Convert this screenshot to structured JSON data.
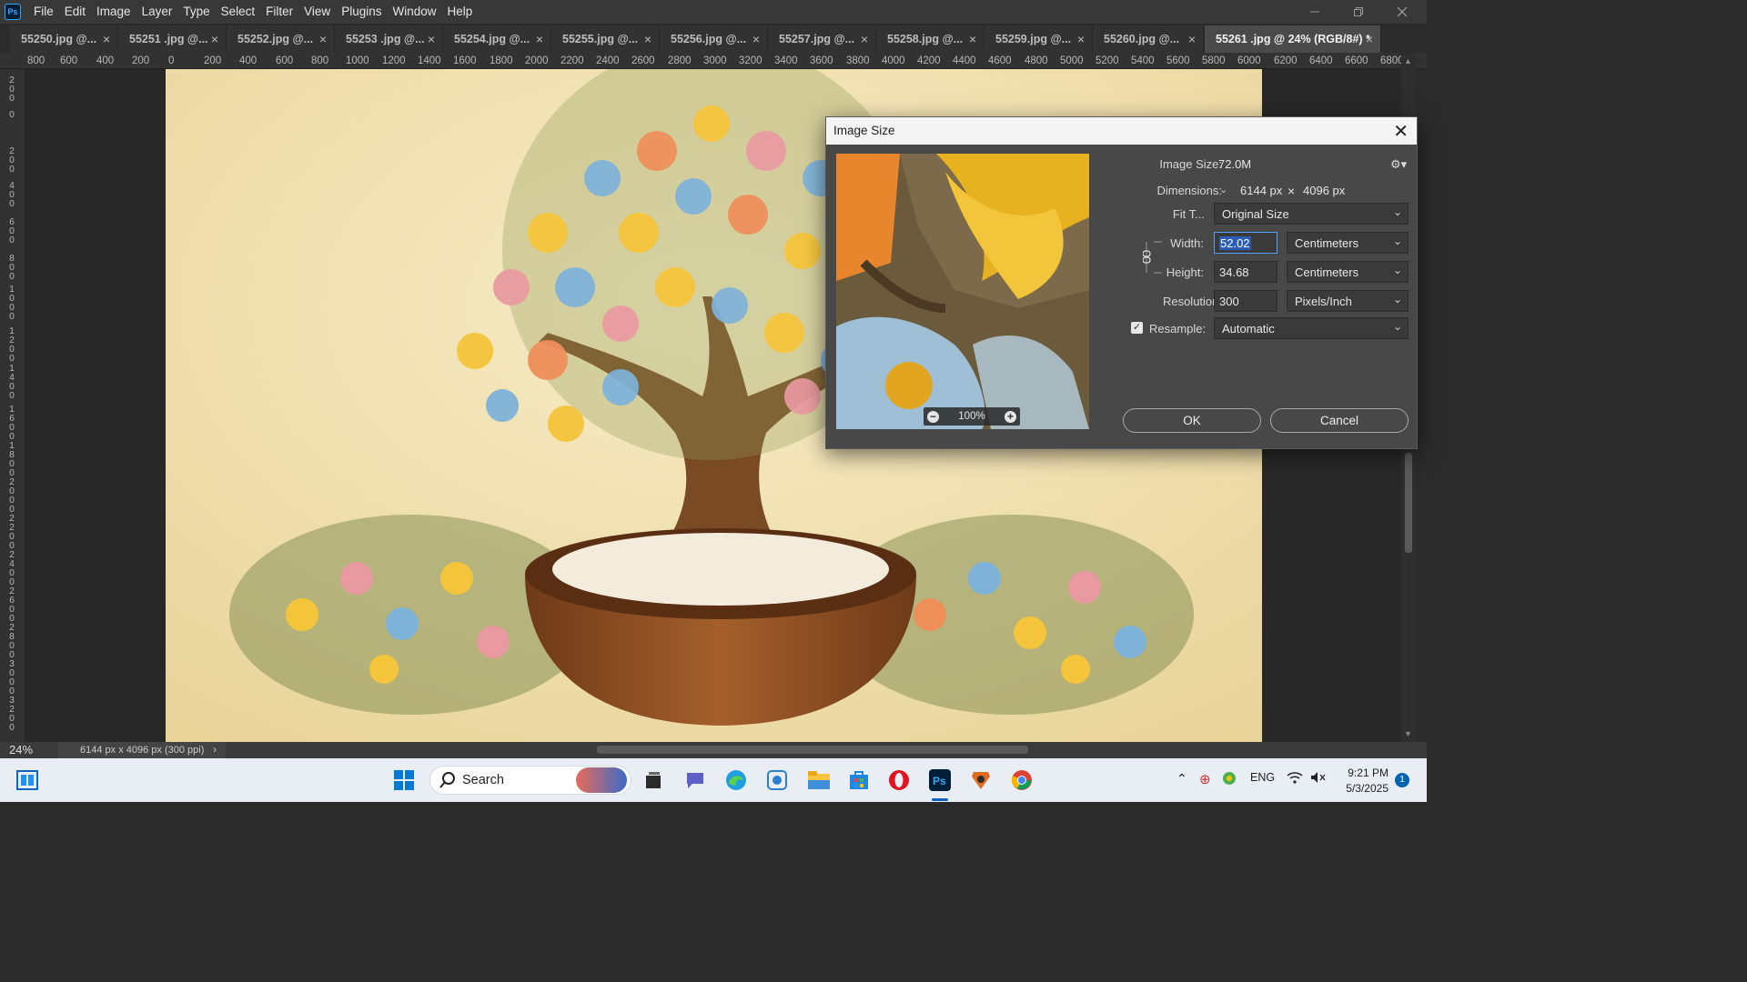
{
  "app": {
    "logo_text": "Ps"
  },
  "menu": [
    "File",
    "Edit",
    "Image",
    "Layer",
    "Type",
    "Select",
    "Filter",
    "View",
    "Plugins",
    "Window",
    "Help"
  ],
  "tabs": [
    {
      "label": "55250.jpg @...",
      "active": false
    },
    {
      "label": "55251 .jpg @...",
      "active": false
    },
    {
      "label": "55252.jpg @...",
      "active": false
    },
    {
      "label": "55253 .jpg @...",
      "active": false
    },
    {
      "label": "55254.jpg @...",
      "active": false
    },
    {
      "label": "55255.jpg @...",
      "active": false
    },
    {
      "label": "55256.jpg @...",
      "active": false
    },
    {
      "label": "55257.jpg @...",
      "active": false
    },
    {
      "label": "55258.jpg @...",
      "active": false
    },
    {
      "label": "55259.jpg @...",
      "active": false
    },
    {
      "label": "55260.jpg @...",
      "active": false
    },
    {
      "label": "55261 .jpg @ 24% (RGB/8#) *",
      "active": true
    }
  ],
  "ruler_top": [
    "800",
    "600",
    "400",
    "200",
    "0",
    "200",
    "400",
    "600",
    "800",
    "1000",
    "1200",
    "1400",
    "1600",
    "1800",
    "2000",
    "2200",
    "2400",
    "2600",
    "2800",
    "3000",
    "3200",
    "3400",
    "3600",
    "3800",
    "4000",
    "4200",
    "4400",
    "4600",
    "4800",
    "5000",
    "5200",
    "5400",
    "5600",
    "5800",
    "6000",
    "6200",
    "6400",
    "6600",
    "6800"
  ],
  "ruler_left": [
    "200",
    "0",
    "200",
    "400",
    "600",
    "800",
    "1000",
    "1200",
    "1400",
    "1600",
    "1800",
    "2000",
    "2200",
    "2400",
    "2600",
    "2800",
    "3000",
    "3200",
    "3400",
    "3600"
  ],
  "status": {
    "zoom": "24%",
    "doc_info": "6144 px x 4096 px (300 ppi)",
    "arrow": "›"
  },
  "dialog": {
    "title": "Image Size",
    "image_size_label": "Image Size:",
    "image_size_value": "72.0M",
    "dimensions_label": "Dimensions:",
    "dim_width": "6144 px",
    "dim_x": "×",
    "dim_height": "4096 px",
    "fit_label": "Fit T...",
    "fit_value": "Original Size",
    "width_label": "Width:",
    "width_value": "52.02",
    "width_unit": "Centimeters",
    "height_label": "Height:",
    "height_value": "34.68",
    "height_unit": "Centimeters",
    "resolution_label": "Resolution:",
    "resolution_value": "300",
    "resolution_unit": "Pixels/Inch",
    "resample_label": "Resample:",
    "resample_checked": true,
    "resample_value": "Automatic",
    "preview_zoom": "100%",
    "ok": "OK",
    "cancel": "Cancel"
  },
  "taskbar": {
    "search_label": "Search",
    "language": "ENG",
    "time": "9:21 PM",
    "date": "5/3/2025",
    "notifications": "1"
  }
}
